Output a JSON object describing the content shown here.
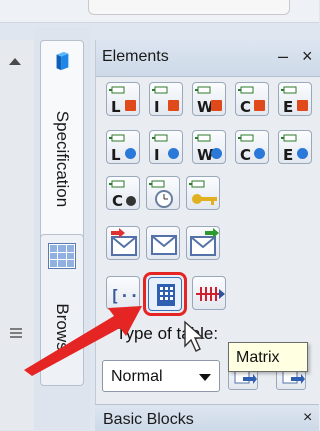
{
  "vertical_tabs": [
    {
      "label": "Specification",
      "icon": "cube-icon"
    },
    {
      "label": "Brows",
      "icon": "grid-icon"
    }
  ],
  "panel": {
    "title": "Elements",
    "minimize": "–",
    "close": "×"
  },
  "palette_rows": [
    [
      {
        "name": "requirement-L-red",
        "letter": "L",
        "color": "#e04a1a"
      },
      {
        "name": "requirement-I-red",
        "letter": "I",
        "color": "#e04a1a"
      },
      {
        "name": "requirement-W-red",
        "letter": "W",
        "color": "#e04a1a"
      },
      {
        "name": "requirement-C-red",
        "letter": "C",
        "color": "#e04a1a"
      },
      {
        "name": "requirement-E-red",
        "letter": "E",
        "color": "#e04a1a"
      }
    ],
    [
      {
        "name": "requirement-L-blue",
        "letter": "L",
        "color": "#2a78d8"
      },
      {
        "name": "requirement-I-blue",
        "letter": "I",
        "color": "#2a78d8"
      },
      {
        "name": "requirement-W-blue",
        "letter": "W",
        "color": "#2a78d8"
      },
      {
        "name": "requirement-C-blue",
        "letter": "C",
        "color": "#2a78d8"
      },
      {
        "name": "requirement-E-blue",
        "letter": "E",
        "color": "#2a78d8"
      }
    ]
  ],
  "type_of_table_label": "Type of table:",
  "table_type_select": {
    "value": "Normal"
  },
  "tooltip": "Matrix",
  "bottom_section": "Basic Blocks",
  "bottom_section_close": "×",
  "colors": {
    "highlight": "#e52424",
    "arrow": "#e52424",
    "tooltip_bg": "#ffffe1"
  }
}
